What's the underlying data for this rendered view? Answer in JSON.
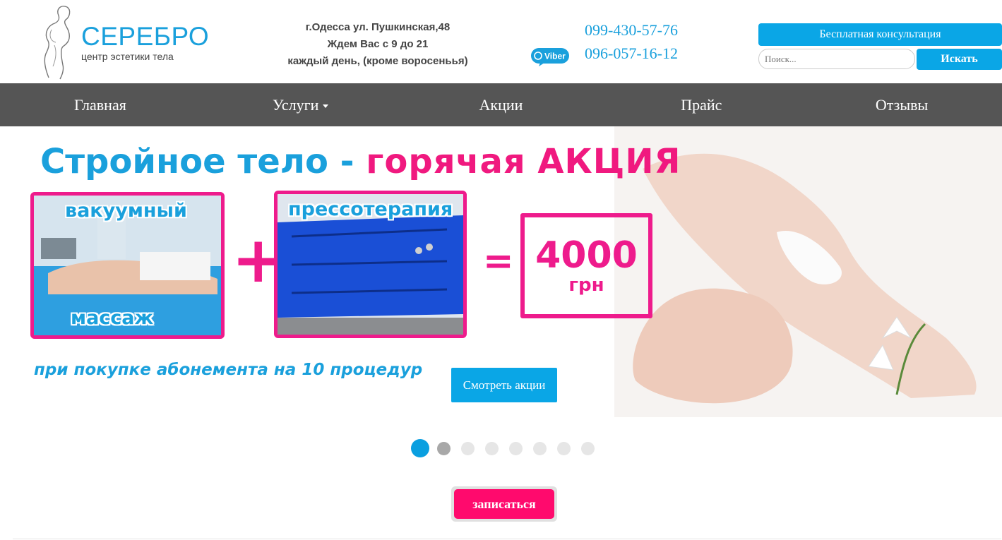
{
  "logo": {
    "name": "СЕРЕБРО",
    "tagline": "центр эстетики тела"
  },
  "contact": {
    "address": "г.Одесса ул. Пушкинская,48",
    "hours1": "Ждем Вас с 9 до 21",
    "hours2": "каждый день, (кроме воросеньья)",
    "phone1": "099-430-57-76",
    "phone2": "096-057-16-12",
    "viber_label": "Viber"
  },
  "header": {
    "consult_label": "Бесплатная консультация",
    "search_placeholder": "Поиск...",
    "search_button": "Искать"
  },
  "nav": {
    "items": [
      {
        "label": "Главная"
      },
      {
        "label": "Услуги"
      },
      {
        "label": "Акции"
      },
      {
        "label": "Прайс"
      },
      {
        "label": "Отзывы"
      }
    ]
  },
  "banner": {
    "title_part1": "Стройное тело - ",
    "title_part2": "горячая",
    "title_part3": "АКЦИЯ",
    "item1_top": "вакуумный",
    "item1_bottom": "массаж",
    "item2": "прессотерапия",
    "plus": "+",
    "equals": "=",
    "price": "4000",
    "currency": "грн",
    "note": "при покупке абонемента на 10 процедур",
    "button": "Смотреть акции"
  },
  "slider": {
    "count": 8,
    "active_index": 0
  },
  "signup": {
    "button": "записаться"
  },
  "colors": {
    "brand_blue": "#1aa0dc",
    "button_blue": "#0aa6e6",
    "pink": "#ee1b8c",
    "signup_pink": "#ff0a6d",
    "nav_bg": "#555555"
  }
}
